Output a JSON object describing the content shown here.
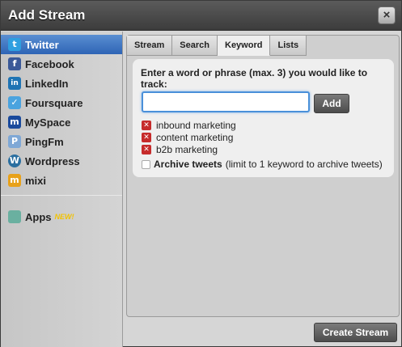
{
  "window": {
    "title": "Add Stream",
    "close_label": "×"
  },
  "sidebar": {
    "items": [
      {
        "label": "Twitter",
        "icon": "twitter-icon",
        "glyph": "t",
        "color": "#2f9fe0",
        "active": true
      },
      {
        "label": "Facebook",
        "icon": "facebook-icon",
        "glyph": "f",
        "color": "#3b5998",
        "active": false
      },
      {
        "label": "LinkedIn",
        "icon": "linkedin-icon",
        "glyph": "in",
        "color": "#1f74b4",
        "active": false
      },
      {
        "label": "Foursquare",
        "icon": "foursquare-icon",
        "glyph": "✓",
        "color": "#4aa3df",
        "active": false
      },
      {
        "label": "MySpace",
        "icon": "myspace-icon",
        "glyph": "m",
        "color": "#1a4a9c",
        "active": false
      },
      {
        "label": "PingFm",
        "icon": "pingfm-icon",
        "glyph": "P",
        "color": "#7fa8d6",
        "active": false
      },
      {
        "label": "Wordpress",
        "icon": "wordpress-icon",
        "glyph": "W",
        "color": "#2b6fa0",
        "active": false
      },
      {
        "label": "mixi",
        "icon": "mixi-icon",
        "glyph": "m",
        "color": "#e8a11a",
        "active": false
      }
    ],
    "apps": {
      "label": "Apps",
      "badge": "NEW!",
      "icon": "apps-icon",
      "color": "#6ab0a0"
    }
  },
  "tabs": [
    {
      "label": "Stream",
      "active": false
    },
    {
      "label": "Search",
      "active": false
    },
    {
      "label": "Keyword",
      "active": true
    },
    {
      "label": "Lists",
      "active": false
    }
  ],
  "keyword_panel": {
    "prompt": "Enter a word or phrase (max. 3) you would like to track:",
    "input_value": "",
    "add_label": "Add",
    "keywords": [
      "inbound marketing",
      "content marketing",
      "b2b marketing"
    ],
    "archive_label": "Archive tweets",
    "archive_note": "(limit to 1 keyword to archive tweets)",
    "archive_checked": false
  },
  "footer": {
    "create_label": "Create Stream"
  },
  "colors": {
    "accent": "#2e64b5",
    "input_focus": "#4a90d9",
    "remove": "#c62b2b",
    "new_badge": "#f2c200"
  }
}
